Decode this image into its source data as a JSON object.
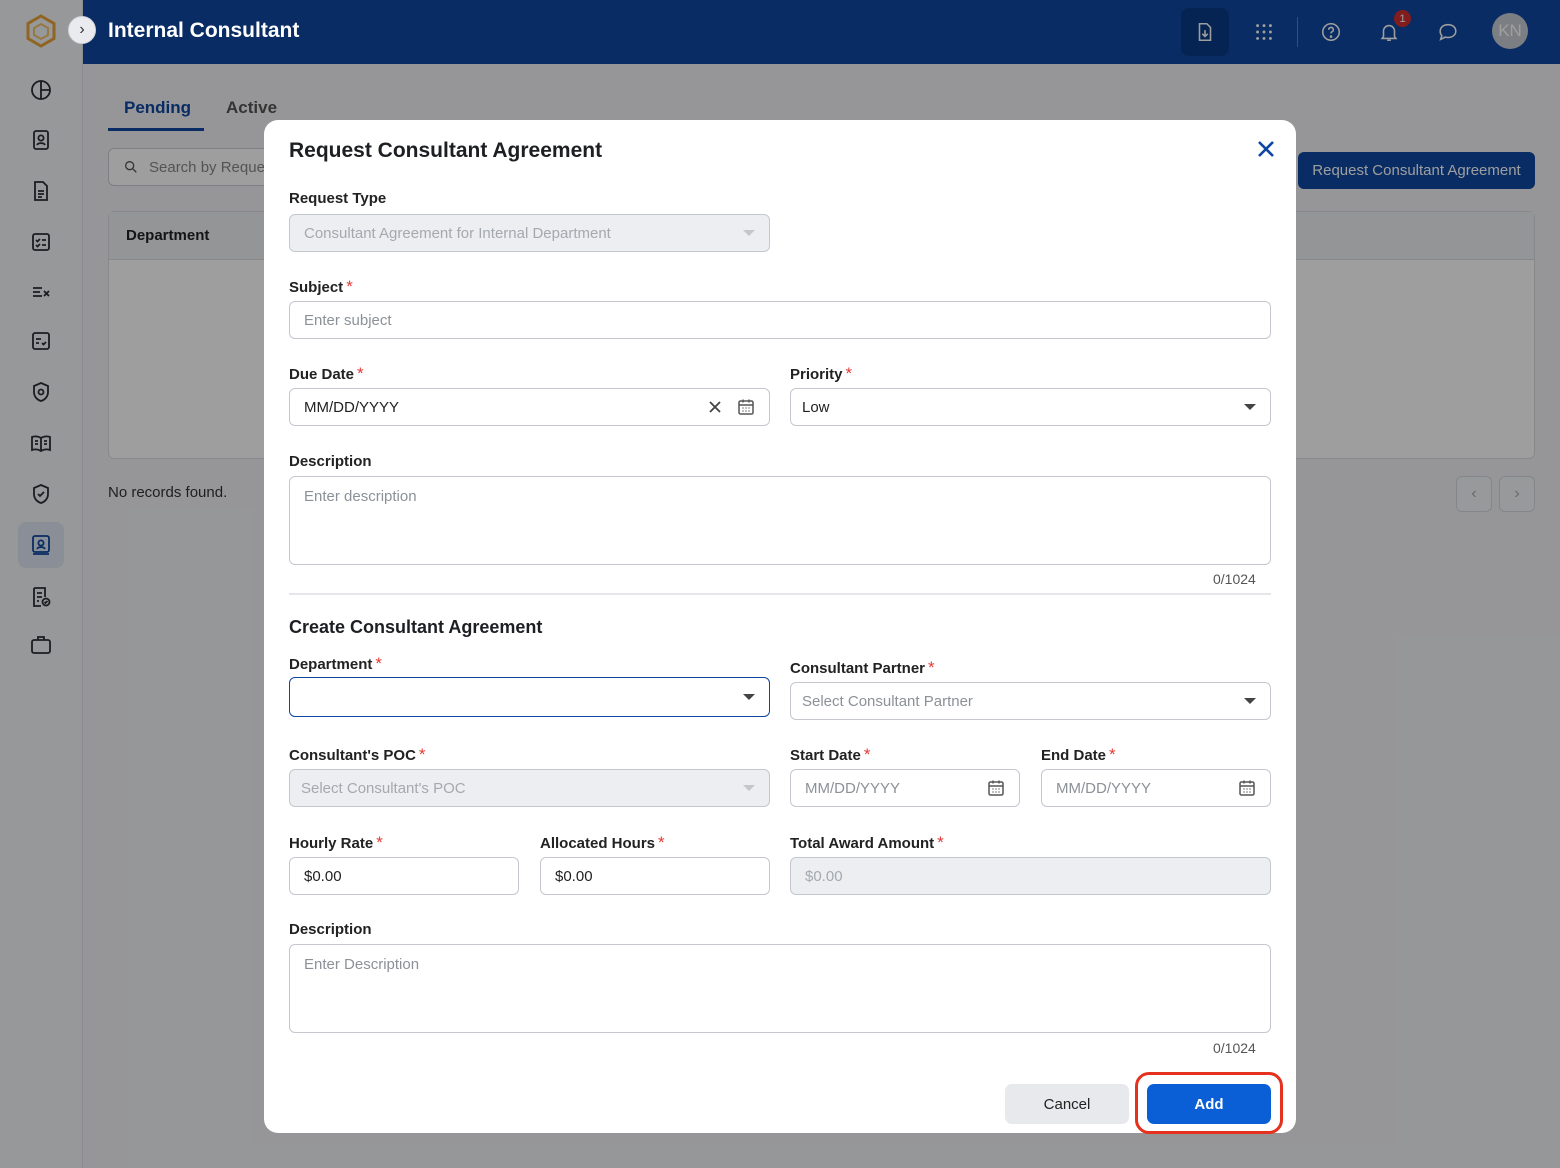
{
  "app": {
    "title": "Internal Consultant",
    "notification_count": "1",
    "user_initials": "KN",
    "accent_color": "#0d47a1"
  },
  "sidebar": {
    "items": [
      {
        "icon": "dashboard-icon"
      },
      {
        "icon": "contacts-icon"
      },
      {
        "icon": "document-icon"
      },
      {
        "icon": "checklist-icon"
      },
      {
        "icon": "tasks-icon"
      },
      {
        "icon": "review-icon"
      },
      {
        "icon": "security-icon"
      },
      {
        "icon": "book-icon"
      },
      {
        "icon": "shield-check-icon"
      },
      {
        "icon": "internal-consultant-icon",
        "active": true
      },
      {
        "icon": "approvals-icon"
      },
      {
        "icon": "briefcase-icon"
      }
    ]
  },
  "page": {
    "tabs": [
      {
        "label": "Pending",
        "active": true
      },
      {
        "label": "Active",
        "active": false
      }
    ],
    "search_placeholder": "Search by Request",
    "request_button_label": "Request Consultant Agreement",
    "table_header": "Department",
    "empty_message": "No records found."
  },
  "modal": {
    "title": "Request Consultant Agreement",
    "request_type": {
      "label": "Request Type",
      "value": "Consultant Agreement for Internal Department"
    },
    "subject": {
      "label": "Subject",
      "placeholder": "Enter subject",
      "required": "*"
    },
    "due_date": {
      "label": "Due Date",
      "value": "MM/DD/YYYY",
      "required": "*"
    },
    "priority": {
      "label": "Priority",
      "value": "Low",
      "required": "*"
    },
    "description": {
      "label": "Description",
      "placeholder": "Enter description",
      "counter": "0/1024"
    },
    "section_title": "Create Consultant Agreement",
    "department": {
      "label": "Department",
      "value": "",
      "required": "*"
    },
    "consultant_partner": {
      "label": "Consultant Partner",
      "placeholder": "Select Consultant Partner",
      "required": "*"
    },
    "consultant_poc": {
      "label": "Consultant's POC",
      "placeholder": "Select Consultant's POC",
      "required": "*"
    },
    "start_date": {
      "label": "Start Date",
      "placeholder": "MM/DD/YYYY",
      "required": "*"
    },
    "end_date": {
      "label": "End Date",
      "placeholder": "MM/DD/YYYY",
      "required": "*"
    },
    "hourly_rate": {
      "label": "Hourly Rate",
      "value": "$0.00",
      "required": "*"
    },
    "allocated_hours": {
      "label": "Allocated Hours",
      "value": "$0.00",
      "required": "*"
    },
    "total_award_amount": {
      "label": "Total Award Amount",
      "value": "$0.00",
      "required": "*"
    },
    "agreement_description": {
      "label": "Description",
      "placeholder": "Enter Description",
      "counter": "0/1024"
    },
    "cancel_label": "Cancel",
    "add_label": "Add",
    "highlight_color": "#e5311d"
  }
}
